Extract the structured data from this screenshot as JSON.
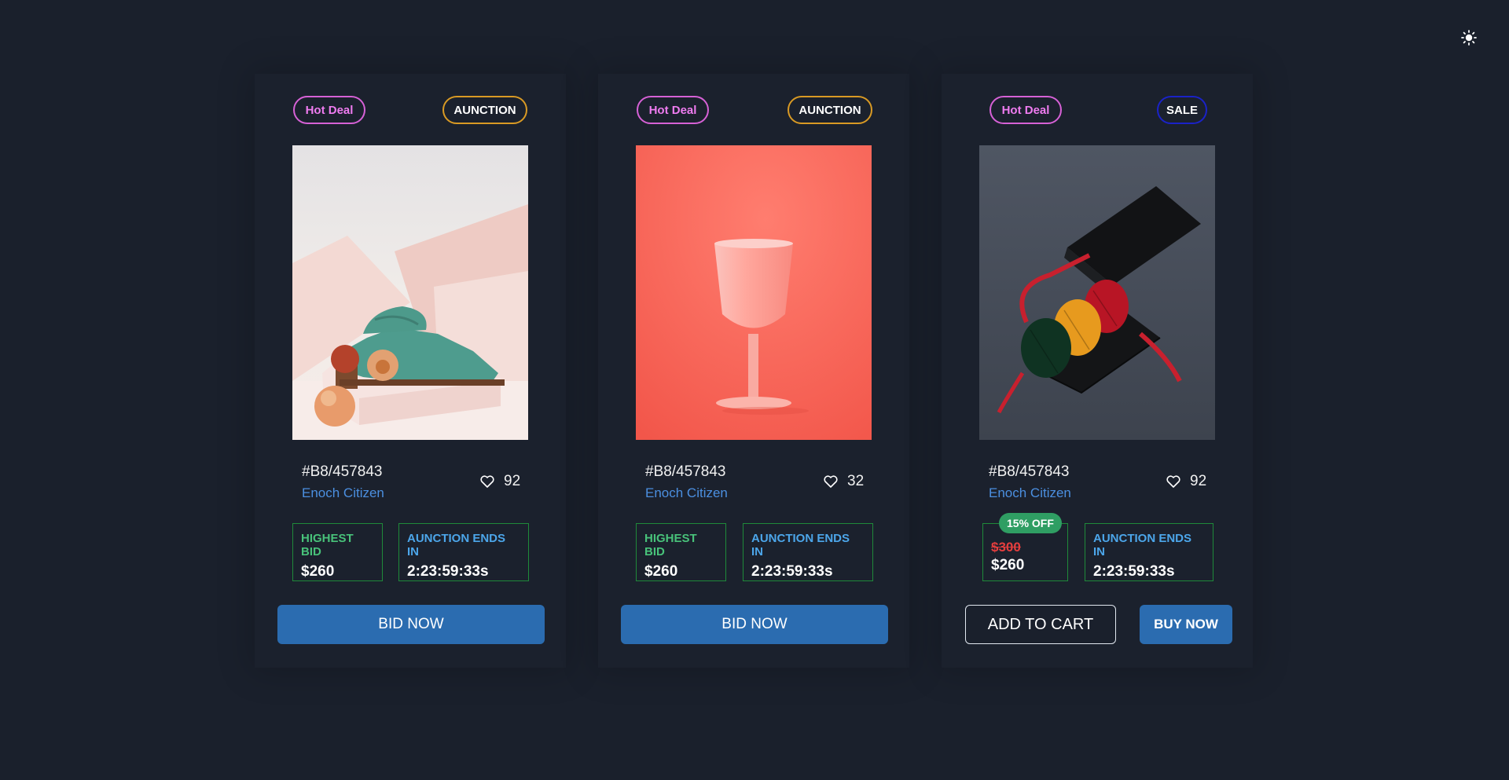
{
  "theme_toggle_icon": "sun-icon",
  "cards": [
    {
      "tag": "Hot Deal",
      "type": "AUNCTION",
      "image": "green-suede-shoe-photo",
      "sku": "#B8/457843",
      "seller": "Enoch Citizen",
      "likes": "92",
      "bid_label": "HIGHEST BID",
      "bid_value": "$260",
      "ends_label": "AUNCTION ENDS IN",
      "ends_value": "2:23:59:33s",
      "action": "BID NOW"
    },
    {
      "tag": "Hot Deal",
      "type": "AUNCTION",
      "image": "pink-goblet-photo",
      "sku": "#B8/457843",
      "seller": "Enoch Citizen",
      "likes": "32",
      "bid_label": "HIGHEST BID",
      "bid_value": "$260",
      "ends_label": "AUNCTION ENDS IN",
      "ends_value": "2:23:59:33s",
      "action": "BID NOW"
    },
    {
      "tag": "Hot Deal",
      "type": "SALE",
      "image": "socks-gift-box-photo",
      "sku": "#B8/457843",
      "seller": "Enoch Citizen",
      "likes": "92",
      "discount": "15% OFF",
      "old_price": "$300",
      "new_price": "$260",
      "ends_label": "AUNCTION ENDS IN",
      "ends_value": "2:23:59:33s",
      "cart_action": "ADD TO CART",
      "buy_action": "BUY NOW"
    }
  ],
  "colors": {
    "background": "#1a202c",
    "primary_button": "#2b6cb0",
    "hot_deal": "#ef7cf0",
    "auction_border": "#d99a24",
    "sale_border": "#1a22c8",
    "box_border": "#1f8a3a",
    "discount_badge": "#2f9e63"
  }
}
